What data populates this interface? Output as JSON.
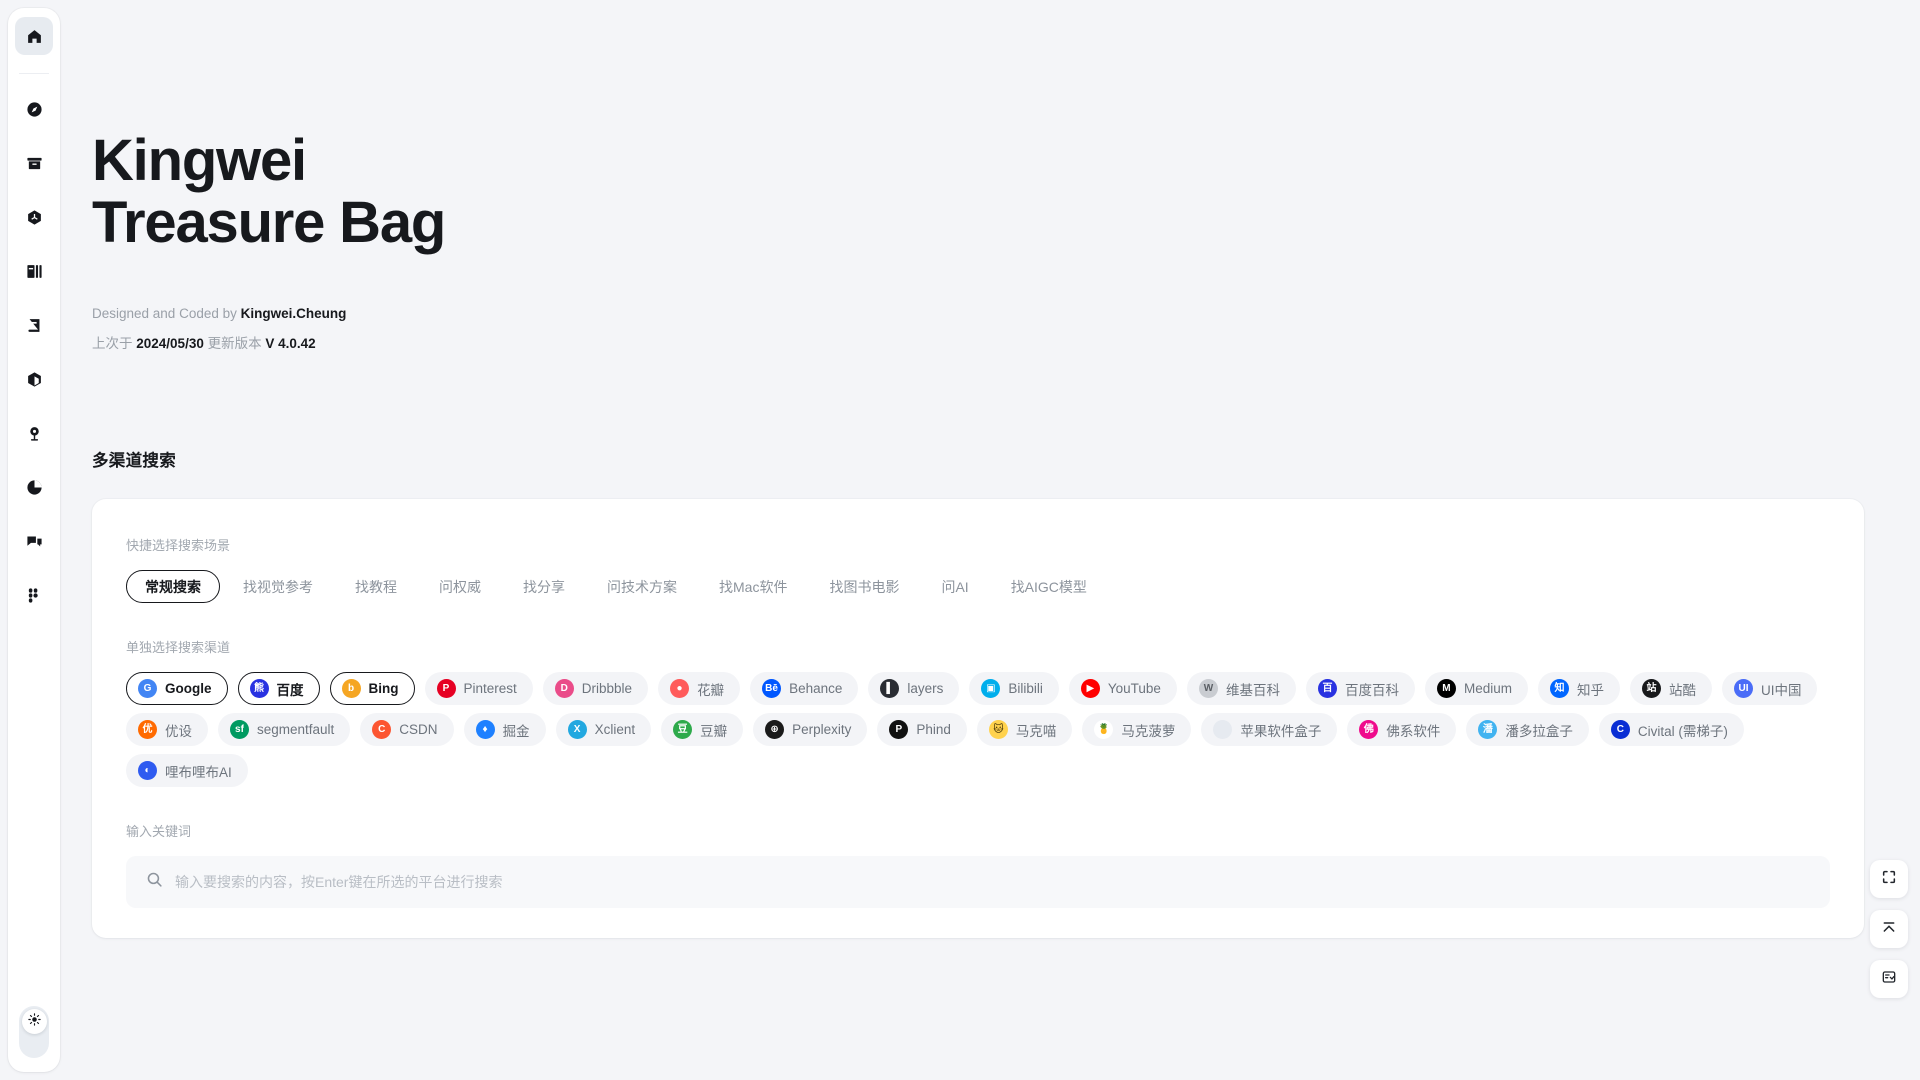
{
  "sidebar": {
    "items": [
      {
        "name": "home",
        "icon": "home-icon",
        "active": true
      },
      {
        "name": "discover",
        "icon": "compass-icon",
        "active": false
      },
      {
        "name": "archive",
        "icon": "archive-icon",
        "active": false
      },
      {
        "name": "unity",
        "icon": "unity-cube-icon",
        "active": false
      },
      {
        "name": "library",
        "icon": "books-icon",
        "active": false
      },
      {
        "name": "notebook",
        "icon": "notebook-icon",
        "active": false
      },
      {
        "name": "package",
        "icon": "box-3d-icon",
        "active": false
      },
      {
        "name": "pin",
        "icon": "map-pin-icon",
        "active": false
      },
      {
        "name": "analytics",
        "icon": "pie-chart-icon",
        "active": false
      },
      {
        "name": "messages",
        "icon": "chat-icon",
        "active": false
      },
      {
        "name": "figma",
        "icon": "figma-icon",
        "active": false
      }
    ],
    "theme_toggle_icon": "sun-icon"
  },
  "hero": {
    "title_line1": "Kingwei",
    "title_line2": "Treasure Bag",
    "credit_prefix": "Designed and Coded by ",
    "credit_author": "Kingwei.Cheung",
    "version_prefix": "上次于 ",
    "version_date": "2024/05/30",
    "version_mid": " 更新版本 ",
    "version_number": "V 4.0.42"
  },
  "section": {
    "title": "多渠道搜索"
  },
  "scenarios": {
    "label": "快捷选择搜索场景",
    "items": [
      {
        "label": "常规搜索",
        "active": true
      },
      {
        "label": "找视觉参考",
        "active": false
      },
      {
        "label": "找教程",
        "active": false
      },
      {
        "label": "问权威",
        "active": false
      },
      {
        "label": "找分享",
        "active": false
      },
      {
        "label": "问技术方案",
        "active": false
      },
      {
        "label": "找Mac软件",
        "active": false
      },
      {
        "label": "找图书电影",
        "active": false
      },
      {
        "label": "问AI",
        "active": false
      },
      {
        "label": "找AIGC模型",
        "active": false
      }
    ]
  },
  "channels": {
    "label": "单独选择搜索渠道",
    "items": [
      {
        "label": "Google",
        "selected": true,
        "glyph": "G",
        "bg": "#4285f4",
        "fg": "#ffffff"
      },
      {
        "label": "百度",
        "selected": true,
        "glyph": "熊",
        "bg": "#2932e1",
        "fg": "#ffffff"
      },
      {
        "label": "Bing",
        "selected": true,
        "glyph": "b",
        "bg": "#f5a623",
        "fg": "#ffffff"
      },
      {
        "label": "Pinterest",
        "selected": false,
        "glyph": "P",
        "bg": "#e60023",
        "fg": "#ffffff"
      },
      {
        "label": "Dribbble",
        "selected": false,
        "glyph": "D",
        "bg": "#ea4c89",
        "fg": "#ffffff"
      },
      {
        "label": "花瓣",
        "selected": false,
        "glyph": "●",
        "bg": "#ff5b5b",
        "fg": "#ffffff"
      },
      {
        "label": "Behance",
        "selected": false,
        "glyph": "Bē",
        "bg": "#0057ff",
        "fg": "#ffffff"
      },
      {
        "label": "layers",
        "selected": false,
        "glyph": "▌",
        "bg": "#2a2d33",
        "fg": "#ffffff"
      },
      {
        "label": "Bilibili",
        "selected": false,
        "glyph": "▣",
        "bg": "#00aeec",
        "fg": "#ffffff"
      },
      {
        "label": "YouTube",
        "selected": false,
        "glyph": "▶",
        "bg": "#ff0000",
        "fg": "#ffffff"
      },
      {
        "label": "维基百科",
        "selected": false,
        "glyph": "W",
        "bg": "#c9ccd1",
        "fg": "#5a5e64"
      },
      {
        "label": "百度百科",
        "selected": false,
        "glyph": "百",
        "bg": "#2932e1",
        "fg": "#ffffff"
      },
      {
        "label": "Medium",
        "selected": false,
        "glyph": "M",
        "bg": "#000000",
        "fg": "#ffffff"
      },
      {
        "label": "知乎",
        "selected": false,
        "glyph": "知",
        "bg": "#0066ff",
        "fg": "#ffffff"
      },
      {
        "label": "站酷",
        "selected": false,
        "glyph": "站",
        "bg": "#18191b",
        "fg": "#ffffff"
      },
      {
        "label": "UI中国",
        "selected": false,
        "glyph": "UI",
        "bg": "#4a6cf7",
        "fg": "#ffffff"
      },
      {
        "label": "优设",
        "selected": false,
        "glyph": "优",
        "bg": "#ff6a00",
        "fg": "#ffffff"
      },
      {
        "label": "segmentfault",
        "selected": false,
        "glyph": "sf",
        "bg": "#009a61",
        "fg": "#ffffff"
      },
      {
        "label": "CSDN",
        "selected": false,
        "glyph": "C",
        "bg": "#fc5531",
        "fg": "#ffffff"
      },
      {
        "label": "掘金",
        "selected": false,
        "glyph": "♦",
        "bg": "#1e80ff",
        "fg": "#ffffff"
      },
      {
        "label": "Xclient",
        "selected": false,
        "glyph": "X",
        "bg": "#22a8e0",
        "fg": "#ffffff"
      },
      {
        "label": "豆瓣",
        "selected": false,
        "glyph": "豆",
        "bg": "#2eaa4b",
        "fg": "#ffffff"
      },
      {
        "label": "Perplexity",
        "selected": false,
        "glyph": "⊕",
        "bg": "#1a1a1a",
        "fg": "#ffffff"
      },
      {
        "label": "Phind",
        "selected": false,
        "glyph": "P",
        "bg": "#111111",
        "fg": "#ffffff"
      },
      {
        "label": "马克喵",
        "selected": false,
        "glyph": "🐱",
        "bg": "#ffd24d",
        "fg": "#3a2a00"
      },
      {
        "label": "马克菠萝",
        "selected": false,
        "glyph": "🍍",
        "bg": "#ffffff",
        "fg": "#d8a400"
      },
      {
        "label": "苹果软件盒子",
        "selected": false,
        "glyph": "",
        "bg": "#e6eaf0",
        "fg": "#7b8088"
      },
      {
        "label": "佛系软件",
        "selected": false,
        "glyph": "佛",
        "bg": "#ef0b8c",
        "fg": "#ffffff"
      },
      {
        "label": "潘多拉盒子",
        "selected": false,
        "glyph": "潘",
        "bg": "#41b3f0",
        "fg": "#ffffff"
      },
      {
        "label": "Civital (需梯子)",
        "selected": false,
        "glyph": "C",
        "bg": "#0a2ed4",
        "fg": "#ffffff"
      },
      {
        "label": "哩布哩布AI",
        "selected": false,
        "glyph": "◐",
        "bg": "#2f5bf0",
        "fg": "#ffffff"
      }
    ]
  },
  "keyword": {
    "label": "输入关键词",
    "value": "",
    "placeholder": "输入要搜索的内容，按Enter键在所选的平台进行搜索",
    "search_icon": "search-icon"
  },
  "floating_buttons": [
    {
      "name": "fullscreen-button",
      "icon": "fullscreen-icon"
    },
    {
      "name": "scroll-top-button",
      "icon": "chevron-up-line-icon"
    },
    {
      "name": "feedback-button",
      "icon": "feedback-icon"
    }
  ]
}
